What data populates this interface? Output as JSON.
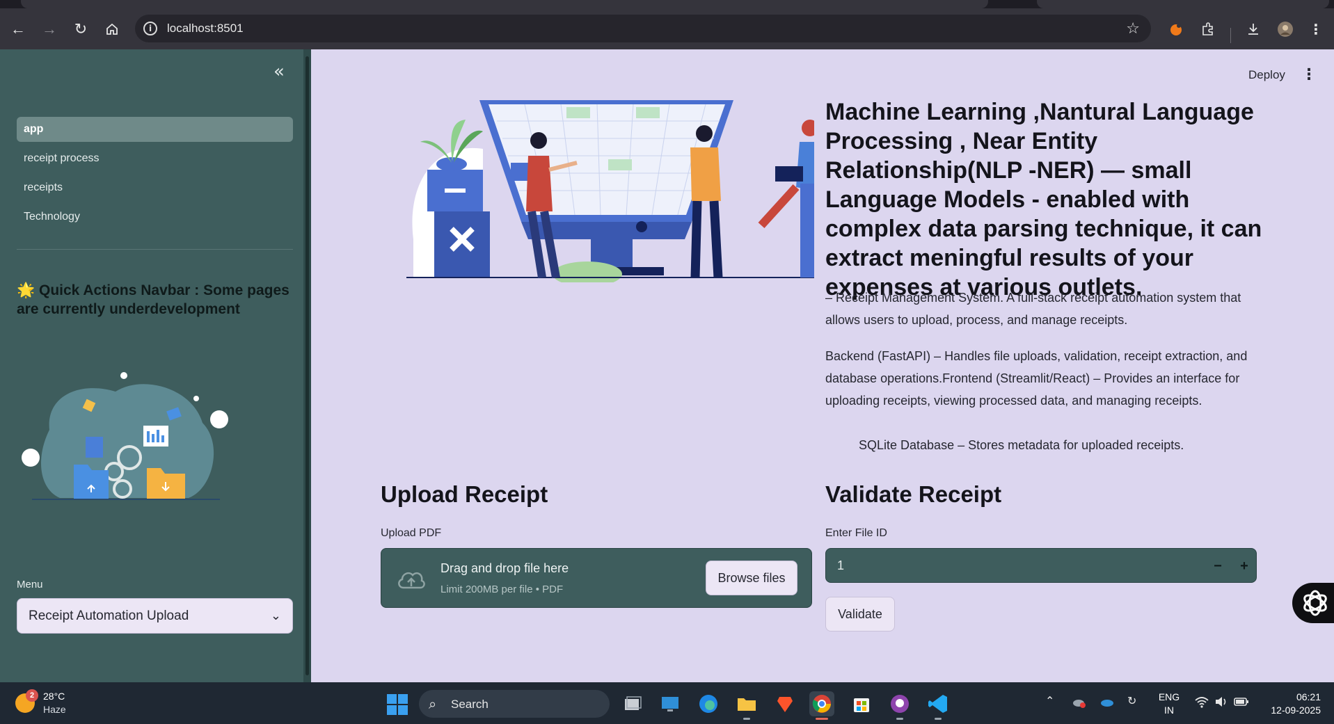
{
  "browser": {
    "url": "localhost:8501"
  },
  "sidebar": {
    "nav_items": [
      {
        "label": "app",
        "active": true
      },
      {
        "label": "receipt process",
        "active": false
      },
      {
        "label": "receipts",
        "active": false
      },
      {
        "label": "Technology",
        "active": false
      }
    ],
    "heading": "🌟 Quick Actions Navbar : Some pages are currently underdevelopment",
    "menu_label": "Menu",
    "menu_selected": "Receipt Automation Upload"
  },
  "header": {
    "deploy_label": "Deploy"
  },
  "main": {
    "title": "Machine Learning ,Nantural Language Processing , Near Entity Relationship(NLP -NER) — small Language Models - enabled with complex data parsing technique, it can extract meningful results of your expenses at various outlets.",
    "para1": "– Receipt Management System. A full-stack receipt automation system that allows users to upload, process, and manage receipts.",
    "para2": "Backend (FastAPI) – Handles file uploads, validation, receipt extraction, and database operations.Frontend (Streamlit/React) – Provides an interface for uploading receipts, viewing processed data, and managing receipts.",
    "para3": "SQLite Database – Stores metadata for uploaded receipts.",
    "upload": {
      "title": "Upload Receipt",
      "label": "Upload PDF",
      "drop_title": "Drag and drop file here",
      "drop_sub": "Limit 200MB per file • PDF",
      "browse_label": "Browse files"
    },
    "validate": {
      "title": "Validate Receipt",
      "label": "Enter File ID",
      "value": "1",
      "minus": "−",
      "plus": "+",
      "button_label": "Validate"
    }
  },
  "taskbar": {
    "weather_badge": "2",
    "temperature": "28°C",
    "condition": "Haze",
    "search_label": "Search",
    "lang_top": "ENG",
    "lang_bottom": "IN",
    "time": "06:21",
    "date": "12-09-2025"
  },
  "colors": {
    "sidebar_bg": "#3e5d5d",
    "main_bg": "#dcd6ef",
    "button_bg": "#ece6f5"
  }
}
